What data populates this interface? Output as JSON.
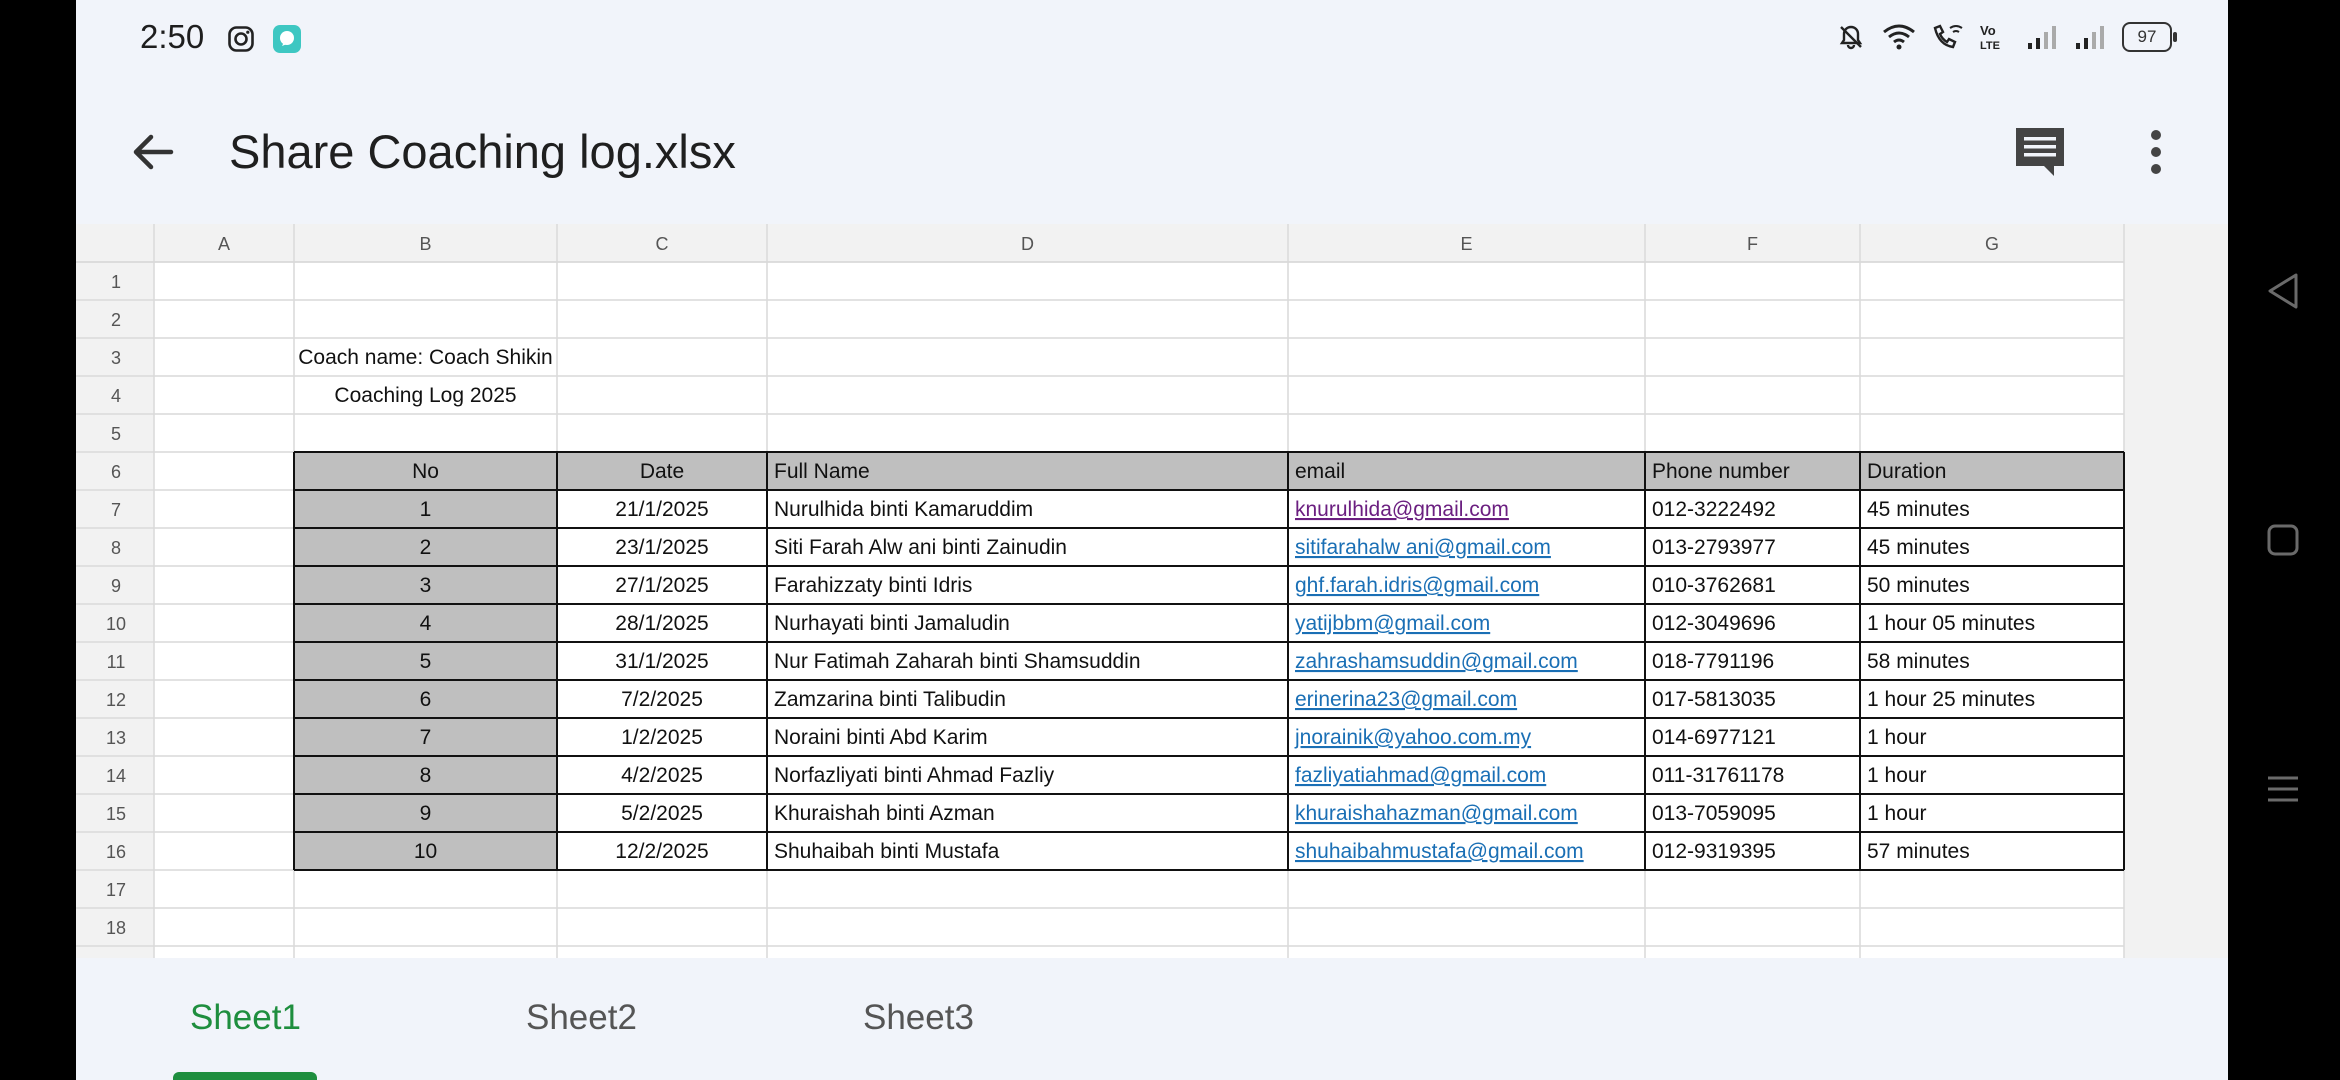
{
  "status_bar": {
    "time": "2:50",
    "battery": "97"
  },
  "app_bar": {
    "title": "Share Coaching log.xlsx"
  },
  "sheet": {
    "columns": [
      "A",
      "B",
      "C",
      "D",
      "E",
      "F",
      "G"
    ],
    "rows": [
      "1",
      "2",
      "3",
      "4",
      "5",
      "6",
      "7",
      "8",
      "9",
      "10",
      "11",
      "12",
      "13",
      "14",
      "15",
      "16",
      "17",
      "18"
    ],
    "coach_name": "Coach name: Coach Shikin",
    "log_title": "Coaching Log 2025",
    "table_headers": [
      "No",
      "Date",
      "Full Name",
      "email",
      "Phone number",
      "Duration"
    ],
    "table_rows": [
      [
        "1",
        "21/1/2025",
        "Nurulhida binti Kamaruddim",
        "knurulhida@gmail.com",
        "012-3222492",
        "45 minutes"
      ],
      [
        "2",
        "23/1/2025",
        "Siti Farah Alw ani binti Zainudin",
        "sitifarahalw ani@gmail.com",
        "013-2793977",
        "45 minutes"
      ],
      [
        "3",
        "27/1/2025",
        "Farahizzaty binti Idris",
        "ghf.farah.idris@gmail.com",
        "010-3762681",
        "50 minutes"
      ],
      [
        "4",
        "28/1/2025",
        "Nurhayati binti Jamaludin",
        "yatijbbm@gmail.com",
        "012-3049696",
        "1 hour 05 minutes"
      ],
      [
        "5",
        "31/1/2025",
        "Nur Fatimah Zaharah binti Shamsuddin",
        "zahrashamsuddin@gmail.com",
        "018-7791196",
        "58 minutes"
      ],
      [
        "6",
        "7/2/2025",
        "Zamzarina binti Talibudin",
        "erinerina23@gmail.com",
        "017-5813035",
        "1 hour 25 minutes"
      ],
      [
        "7",
        "1/2/2025",
        "Noraini binti Abd Karim",
        "jnorainik@yahoo.com.my",
        "014-6977121",
        "1 hour"
      ],
      [
        "8",
        "4/2/2025",
        "Norfazliyati binti Ahmad Fazliy",
        "fazliyatiahmad@gmail.com",
        "011-31761178",
        "1 hour"
      ],
      [
        "9",
        "5/2/2025",
        "Khuraishah binti Azman",
        "khuraishahazman@gmail.com",
        "013-7059095",
        "1 hour"
      ],
      [
        "10",
        "12/2/2025",
        "Shuhaibah binti Mustafa",
        "shuhaibahmustafa@gmail.com",
        "012-9319395",
        "57 minutes"
      ]
    ],
    "colors": {
      "header_fill": "#bfbfbf",
      "link": "#1a6fb5",
      "visited_link": "#6b1f80"
    }
  },
  "tabs": [
    "Sheet1",
    "Sheet2",
    "Sheet3"
  ],
  "active_tab": "Sheet1",
  "icons": [
    "instagram-icon",
    "chat-app-icon",
    "mute-icon",
    "wifi-icon",
    "wifi-calling-icon",
    "volte-icon",
    "signal-icon",
    "back-arrow-icon",
    "comments-icon",
    "more-vert-icon",
    "nav-back-icon",
    "nav-home-icon",
    "nav-recents-icon"
  ]
}
